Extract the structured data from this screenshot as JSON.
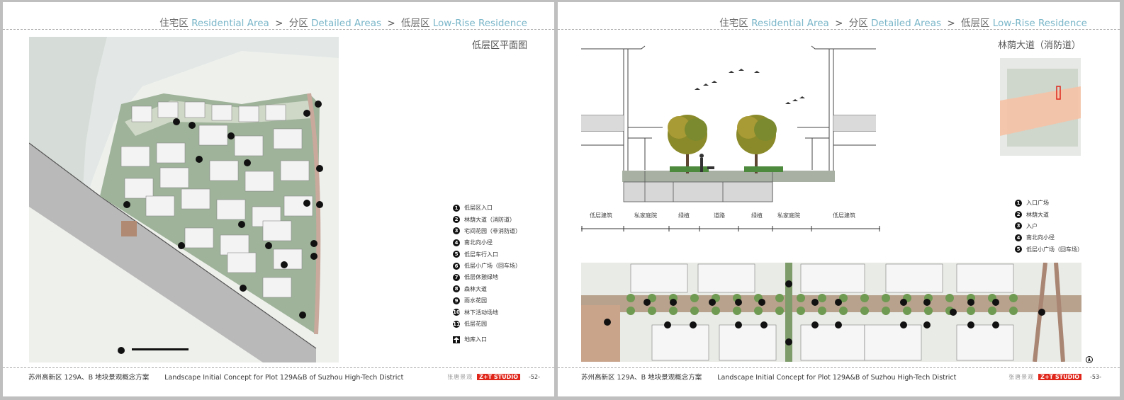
{
  "header": {
    "items": [
      {
        "cn": "住宅区",
        "en": "Residential Area"
      },
      {
        "cn": "分区",
        "en": "Detailed Areas"
      },
      {
        "cn": "低层区",
        "en": "Low-Rise Residence"
      }
    ],
    "separator": ">"
  },
  "footer": {
    "cn": "苏州高新区 129A、B 地块景观概念方案",
    "en": "Landscape Initial Concept for Plot 129A&B of Suzhou High-Tech District",
    "studio_cn": "张唐景观",
    "studio_logo": "Z+T STUDIO"
  },
  "left_page": {
    "title": "低层区平面图",
    "page_number": "-52-",
    "legend": [
      {
        "num": "1",
        "label": "低层区入口"
      },
      {
        "num": "2",
        "label": "林荫大道（消防道）"
      },
      {
        "num": "3",
        "label": "宅间花园（非消防道）"
      },
      {
        "num": "4",
        "label": "南北向小径"
      },
      {
        "num": "5",
        "label": "低层车行入口"
      },
      {
        "num": "6",
        "label": "低层小广场（回车场）"
      },
      {
        "num": "7",
        "label": "低层休憩绿地"
      },
      {
        "num": "8",
        "label": "森林大道"
      },
      {
        "num": "9",
        "label": "雨水花园"
      },
      {
        "num": "10",
        "label": "林下活动场地"
      },
      {
        "num": "11",
        "label": "低层花园"
      }
    ],
    "legend_arrow_label": "地库入口"
  },
  "right_page": {
    "title": "林荫大道（消防道）",
    "page_number": "-53-",
    "section_labels": [
      "低层建筑",
      "私家庭院",
      "绿植",
      "道路",
      "绿植",
      "私家庭院",
      "低层建筑"
    ],
    "legend": [
      {
        "num": "1",
        "label": "入口广场"
      },
      {
        "num": "2",
        "label": "林荫大道"
      },
      {
        "num": "3",
        "label": "入户"
      },
      {
        "num": "4",
        "label": "南北向小径"
      },
      {
        "num": "5",
        "label": "低层小广场（回车场）"
      }
    ]
  },
  "colors": {
    "header_en": "#7ab6c9",
    "logo_red": "#e0261b"
  }
}
